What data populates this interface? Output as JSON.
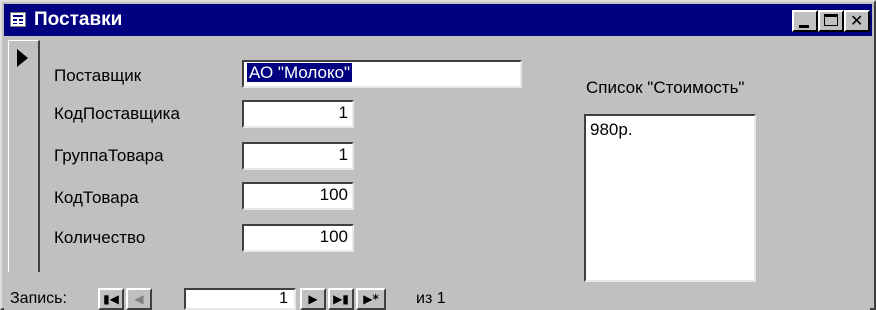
{
  "window": {
    "title": "Поставки"
  },
  "form": {
    "fields": [
      {
        "label": "Поставщик",
        "value": "АО \"Молоко\""
      },
      {
        "label": "КодПоставщика",
        "value": "1"
      },
      {
        "label": "ГруппаТовара",
        "value": "1"
      },
      {
        "label": "КодТовара",
        "value": "100"
      },
      {
        "label": "Количество",
        "value": "100"
      }
    ],
    "list": {
      "label": "Список \"Стоимость\"",
      "items": [
        "980р."
      ]
    }
  },
  "nav": {
    "label": "Запись:",
    "current": "1",
    "total_text": "из  1",
    "buttons": {
      "first": "first-record-icon",
      "prev": "prev-record-icon",
      "next": "next-record-icon",
      "last": "last-record-icon",
      "new": "new-record-icon"
    }
  },
  "colors": {
    "titlebar": "#000080",
    "face": "#c0c0c0",
    "selection": "#000080"
  }
}
